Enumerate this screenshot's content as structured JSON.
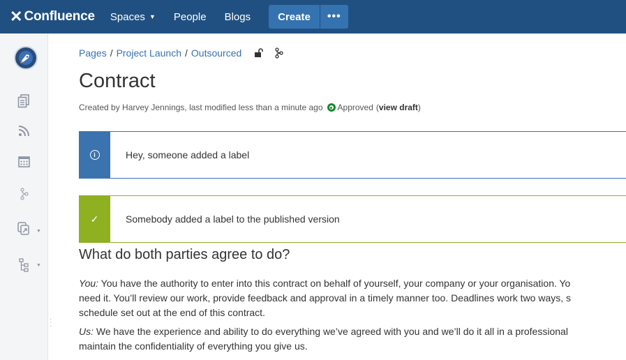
{
  "nav": {
    "logo_mark": "✕",
    "logo_text": "Confluence",
    "spaces": "Spaces",
    "people": "People",
    "blogs": "Blogs",
    "create": "Create",
    "more": "•••"
  },
  "sidebar": {
    "icons": [
      "space-avatar",
      "pages-icon",
      "blog-feed-icon",
      "calendar-icon",
      "hierarchy-icon",
      "shortcut-icon",
      "page-tree-icon"
    ]
  },
  "breadcrumb": {
    "items": [
      "Pages",
      "Project Launch",
      "Outsourced"
    ],
    "separator": "/"
  },
  "page": {
    "title": "Contract",
    "byline": "Created by Harvey Jennings, last modified less than a minute ago",
    "status": "Approved",
    "view_draft_open": "(",
    "view_draft": "view draft",
    "view_draft_close": ")"
  },
  "panels": {
    "info": "Hey, someone added a label",
    "success": "Somebody added a label to the published version"
  },
  "content": {
    "heading": "What do both parties agree to do?",
    "p1_label": "You:",
    "p1_line1": " You have the authority to enter into this contract on behalf of yourself, your company or your organisation. Yo",
    "p1_line2": "need it. You’ll review our work, provide feedback and approval in a timely manner too. Deadlines work two ways, s",
    "p1_line3": "schedule set out at the end of this contract.",
    "p2_label": "Us:",
    "p2_line1": " We have the experience and ability to do everything we’ve agreed with you and we’ll do it all in a professional",
    "p2_line2": "maintain the confidentiality of everything you give us."
  },
  "colors": {
    "nav_bg": "#205081",
    "create_bg": "#3572b0",
    "info": "#3b73af",
    "success": "#8eb021",
    "approved": "#14892c",
    "link": "#3572b0"
  }
}
